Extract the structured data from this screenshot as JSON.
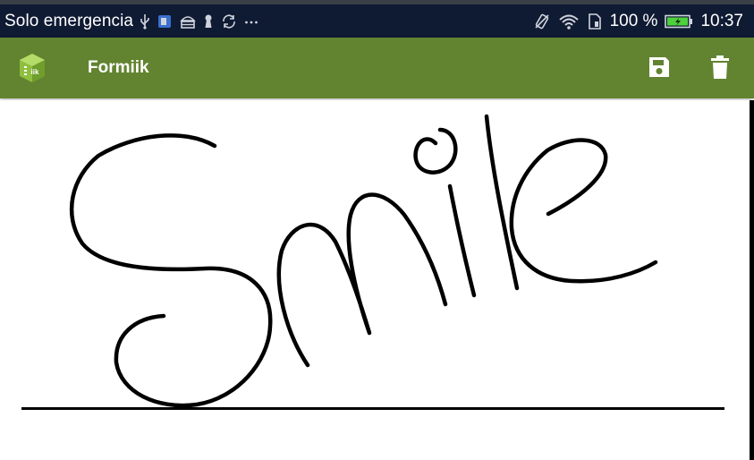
{
  "status_bar": {
    "carrier": "Solo emergencia",
    "left_icons": [
      "usb-icon",
      "screenshot-icon",
      "android-debug-icon",
      "keyhole-icon",
      "sync-icon",
      "more-icon"
    ],
    "right_icons": [
      "vibrate-icon",
      "wifi-icon",
      "sim-icon",
      "battery-icon"
    ],
    "battery_percent": "100 %",
    "battery_charging": true,
    "time": "10:37"
  },
  "app_bar": {
    "title": "Formiik",
    "background_color": "#628330",
    "actions": [
      "save-icon",
      "delete-icon"
    ]
  },
  "canvas": {
    "handwriting": "Smile",
    "background_color": "#ffffff",
    "stroke_color": "#000000"
  }
}
